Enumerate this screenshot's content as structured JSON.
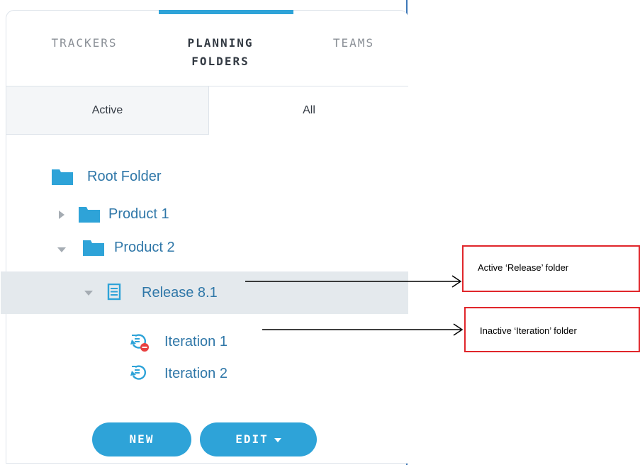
{
  "tabs": {
    "trackers": "TRACKERS",
    "planning_line1": "PLANNING",
    "planning_line2": "FOLDERS",
    "teams": "TEAMS"
  },
  "subtabs": {
    "active": "Active",
    "all": "All"
  },
  "tree": {
    "root": "Root Folder",
    "product1": "Product 1",
    "product2": "Product 2",
    "release": "Release 8.1",
    "iteration1": "Iteration 1",
    "iteration2": "Iteration 2"
  },
  "buttons": {
    "new": "NEW",
    "edit": "EDIT"
  },
  "callouts": {
    "release": "Active ‘Release’ folder",
    "iteration": "Inactive ‘Iteration’ folder"
  },
  "colors": {
    "accent": "#2ea3d8",
    "link": "#2f77a8",
    "selected_row": "#e4e9ed",
    "callout_border": "#e0262b",
    "inactive_badge": "#e84040"
  },
  "icons": {
    "folder": "folder-icon",
    "release": "release-list-icon",
    "iteration": "iteration-icon",
    "iteration_inactive": "iteration-inactive-icon",
    "expand": "caret-right-icon",
    "collapse": "caret-down-icon"
  }
}
